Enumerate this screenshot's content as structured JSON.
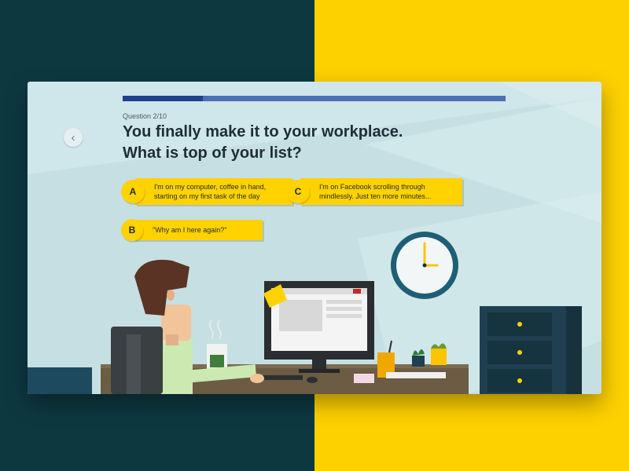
{
  "quiz": {
    "progress_fraction": 0.21,
    "question_counter": "Question 2/10",
    "question_line1": "You finally make it to your workplace.",
    "question_line2": "What is top of your list?",
    "answers": [
      {
        "letter": "A",
        "text": "I'm on my computer, coffee in hand, starting on my first task of the day"
      },
      {
        "letter": "C",
        "text": "I'm on Facebook scrolling through mindlessly. Just ten more minutes..."
      },
      {
        "letter": "B",
        "text": "\"Why am I here again?\""
      }
    ]
  },
  "icons": {
    "back": "chevron-left-icon"
  },
  "colors": {
    "left_background": "#0e3840",
    "right_background": "#fdd000",
    "card_background": "#cfe6ea",
    "answer_yellow": "#ffd200",
    "progress_track": "#4a6fb4",
    "progress_fill": "#1f3f8f"
  }
}
